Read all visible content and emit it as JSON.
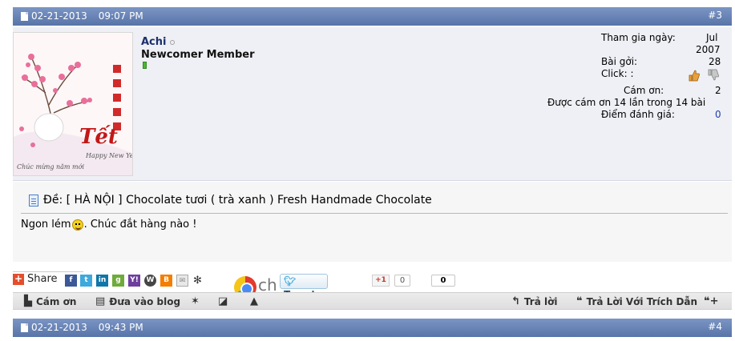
{
  "post3": {
    "date": "02-21-2013",
    "time": "09:07 PM",
    "number": "#3",
    "user": {
      "name": "Achi",
      "title": "Newcomer Member",
      "avatar_text": {
        "tet": "Tết",
        "happy": "Happy New Year",
        "chuc": "Chúc mừng năm mới"
      }
    },
    "stats": {
      "join_label": "Tham gia ngày:",
      "join_value_1": "Jul",
      "join_value_2": "2007",
      "posts_label": "Bài gởi:",
      "posts_value": "28",
      "click_label": "Click: :",
      "thanks_label": "Cám ơn:",
      "thanks_value": "2",
      "thanked_text": "Được cám ơn 14 lần trong 14 bài",
      "rating_label": "Điểm đánh giá:",
      "rating_value": "0"
    },
    "title": "Đề: [ HÀ NỘI ] Chocolate tươi ( trà xanh ) Fresh Handmade Chocolate",
    "message_before": "Ngon lém",
    "message_after": ". Chúc đắt hàng nào !"
  },
  "share": {
    "share_label": "Share",
    "ch_text": "ch",
    "tweet_label": "Tweet",
    "gplus_label": "+1",
    "gplus_count": "0",
    "like_count": "0"
  },
  "actions": {
    "thanks": "Cám ơn",
    "blog": "Đưa vào blog",
    "reply": "Trả lời",
    "quote_reply": "Trả Lời Với Trích Dẫn"
  },
  "post4": {
    "date": "02-21-2013",
    "time": "09:43 PM",
    "number": "#4"
  },
  "colors": {
    "header_bar": "#6682b8",
    "userinfo_bg": "#eef0f5",
    "rating_link": "#1e3fae"
  }
}
